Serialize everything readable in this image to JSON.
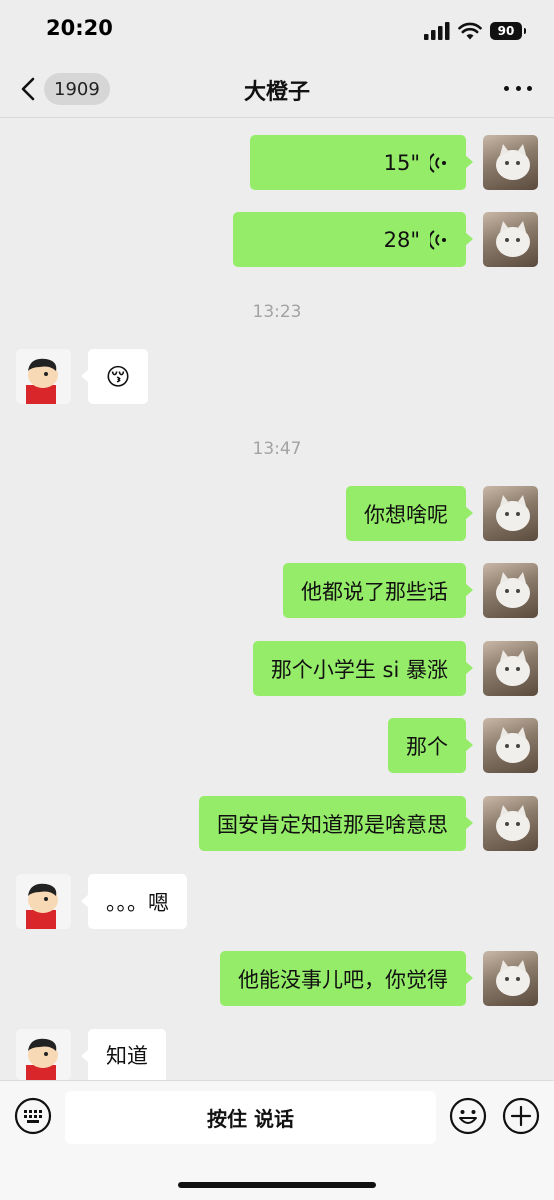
{
  "status_bar": {
    "time": "20:20",
    "battery": "90"
  },
  "nav": {
    "unread_count": "1909",
    "title": "大橙子"
  },
  "messages": {
    "voice1": "15\"",
    "voice2": "28\"",
    "time1": "13:23",
    "emoji1": "😚",
    "time2": "13:47",
    "m1": "你想啥呢",
    "m2": "他都说了那些话",
    "m3": "那个小学生 si 暴涨",
    "m4": "那个",
    "m5": "国安肯定知道那是啥意思",
    "m6": "。。。嗯",
    "m7": "他能没事儿吧，你觉得",
    "m8": "知道"
  },
  "input_bar": {
    "hold_to_talk": "按住 说话"
  }
}
